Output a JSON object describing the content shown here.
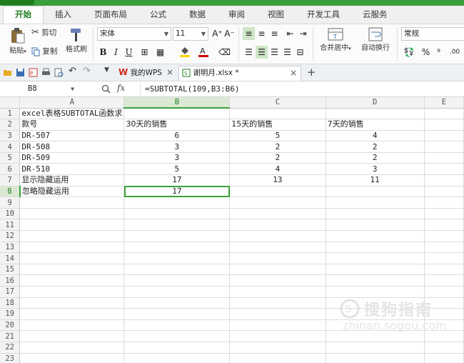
{
  "ribbon": {
    "tabs": [
      "开始",
      "插入",
      "页面布局",
      "公式",
      "数据",
      "审阅",
      "视图",
      "开发工具",
      "云服务"
    ],
    "active_tab": "开始",
    "clipboard": {
      "paste": "粘贴",
      "cut": "剪切",
      "copy": "复制",
      "format_painter": "格式刷"
    },
    "font": {
      "name": "宋体",
      "size": "11",
      "grow": "A⁺",
      "shrink": "A⁻",
      "bold": "B",
      "italic": "I",
      "underline": "U"
    },
    "alignment": {
      "merge_center": "合并居中",
      "wrap_text": "自动换行"
    },
    "number": {
      "format": "常规",
      "percent": "%",
      "comma": "⁹",
      "decimal": ".00"
    },
    "colors": {
      "accent": "#3aa13a",
      "highlight": "#ffd400",
      "font_color": "#d00000"
    }
  },
  "doc_tabs": {
    "wps_home": "我的WPS",
    "active_file": "谢明月.xlsx *",
    "new_tab": "+"
  },
  "formula_bar": {
    "cell_ref": "B8",
    "fx": "fx",
    "formula": "=SUBTOTAL(109,B3:B6)"
  },
  "sheet": {
    "columns": [
      "A",
      "B",
      "C",
      "D",
      "E"
    ],
    "selected_column": "B",
    "selected_row": 8,
    "rows": [
      {
        "n": "1",
        "a": "excel表格SUBTOTAL函数求",
        "b": "",
        "c": "",
        "d": ""
      },
      {
        "n": "2",
        "a": "款号",
        "b": "30天的销售",
        "c": "15天的销售",
        "d": "7天的销售"
      },
      {
        "n": "3",
        "a": "DR-507",
        "b": "6",
        "c": "5",
        "d": "4"
      },
      {
        "n": "4",
        "a": "DR-508",
        "b": "3",
        "c": "2",
        "d": "2"
      },
      {
        "n": "5",
        "a": "DR-509",
        "b": "3",
        "c": "2",
        "d": "2"
      },
      {
        "n": "6",
        "a": "DR-510",
        "b": "5",
        "c": "4",
        "d": "3"
      },
      {
        "n": "7",
        "a": "显示隐藏运用",
        "b": "17",
        "c": "13",
        "d": "11"
      },
      {
        "n": "8",
        "a": "忽略隐藏运用",
        "b": "17",
        "c": "",
        "d": ""
      },
      {
        "n": "9",
        "a": "",
        "b": "",
        "c": "",
        "d": ""
      },
      {
        "n": "10",
        "a": "",
        "b": "",
        "c": "",
        "d": ""
      },
      {
        "n": "11",
        "a": "",
        "b": "",
        "c": "",
        "d": ""
      },
      {
        "n": "12",
        "a": "",
        "b": "",
        "c": "",
        "d": ""
      },
      {
        "n": "13",
        "a": "",
        "b": "",
        "c": "",
        "d": ""
      },
      {
        "n": "14",
        "a": "",
        "b": "",
        "c": "",
        "d": ""
      },
      {
        "n": "15",
        "a": "",
        "b": "",
        "c": "",
        "d": ""
      },
      {
        "n": "16",
        "a": "",
        "b": "",
        "c": "",
        "d": ""
      },
      {
        "n": "17",
        "a": "",
        "b": "",
        "c": "",
        "d": ""
      },
      {
        "n": "18",
        "a": "",
        "b": "",
        "c": "",
        "d": ""
      },
      {
        "n": "19",
        "a": "",
        "b": "",
        "c": "",
        "d": ""
      },
      {
        "n": "20",
        "a": "",
        "b": "",
        "c": "",
        "d": ""
      },
      {
        "n": "21",
        "a": "",
        "b": "",
        "c": "",
        "d": ""
      },
      {
        "n": "22",
        "a": "",
        "b": "",
        "c": "",
        "d": ""
      },
      {
        "n": "23",
        "a": "",
        "b": "",
        "c": "",
        "d": ""
      }
    ]
  },
  "watermark": {
    "cn": "搜狗指南",
    "en": "zhinan.sogou.com"
  }
}
